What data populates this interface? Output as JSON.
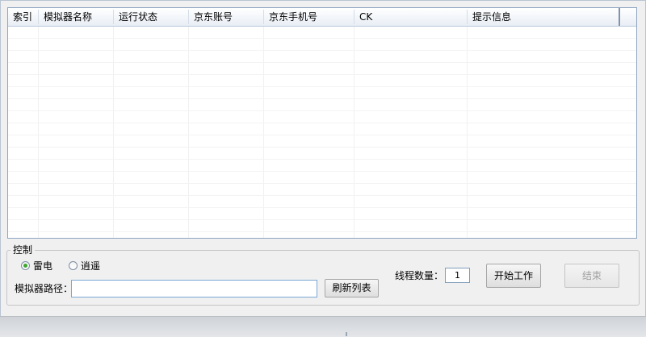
{
  "list": {
    "columns": [
      "索引",
      "模拟器名称",
      "运行状态",
      "京东账号",
      "京东手机号",
      "CK",
      "提示信息"
    ]
  },
  "control": {
    "group_title": "控制",
    "radios": [
      {
        "label": "雷电",
        "checked": true
      },
      {
        "label": "逍遥",
        "checked": false
      }
    ],
    "path_label": "模拟器路径：",
    "path_value": "",
    "refresh_button": "刷新列表",
    "thread_label": "线程数量：",
    "thread_value": "1",
    "start_button": "开始工作",
    "end_button": "结束"
  },
  "colors": {
    "radio_checked": "#3ea52f",
    "header_border": "#8ea4c1"
  }
}
